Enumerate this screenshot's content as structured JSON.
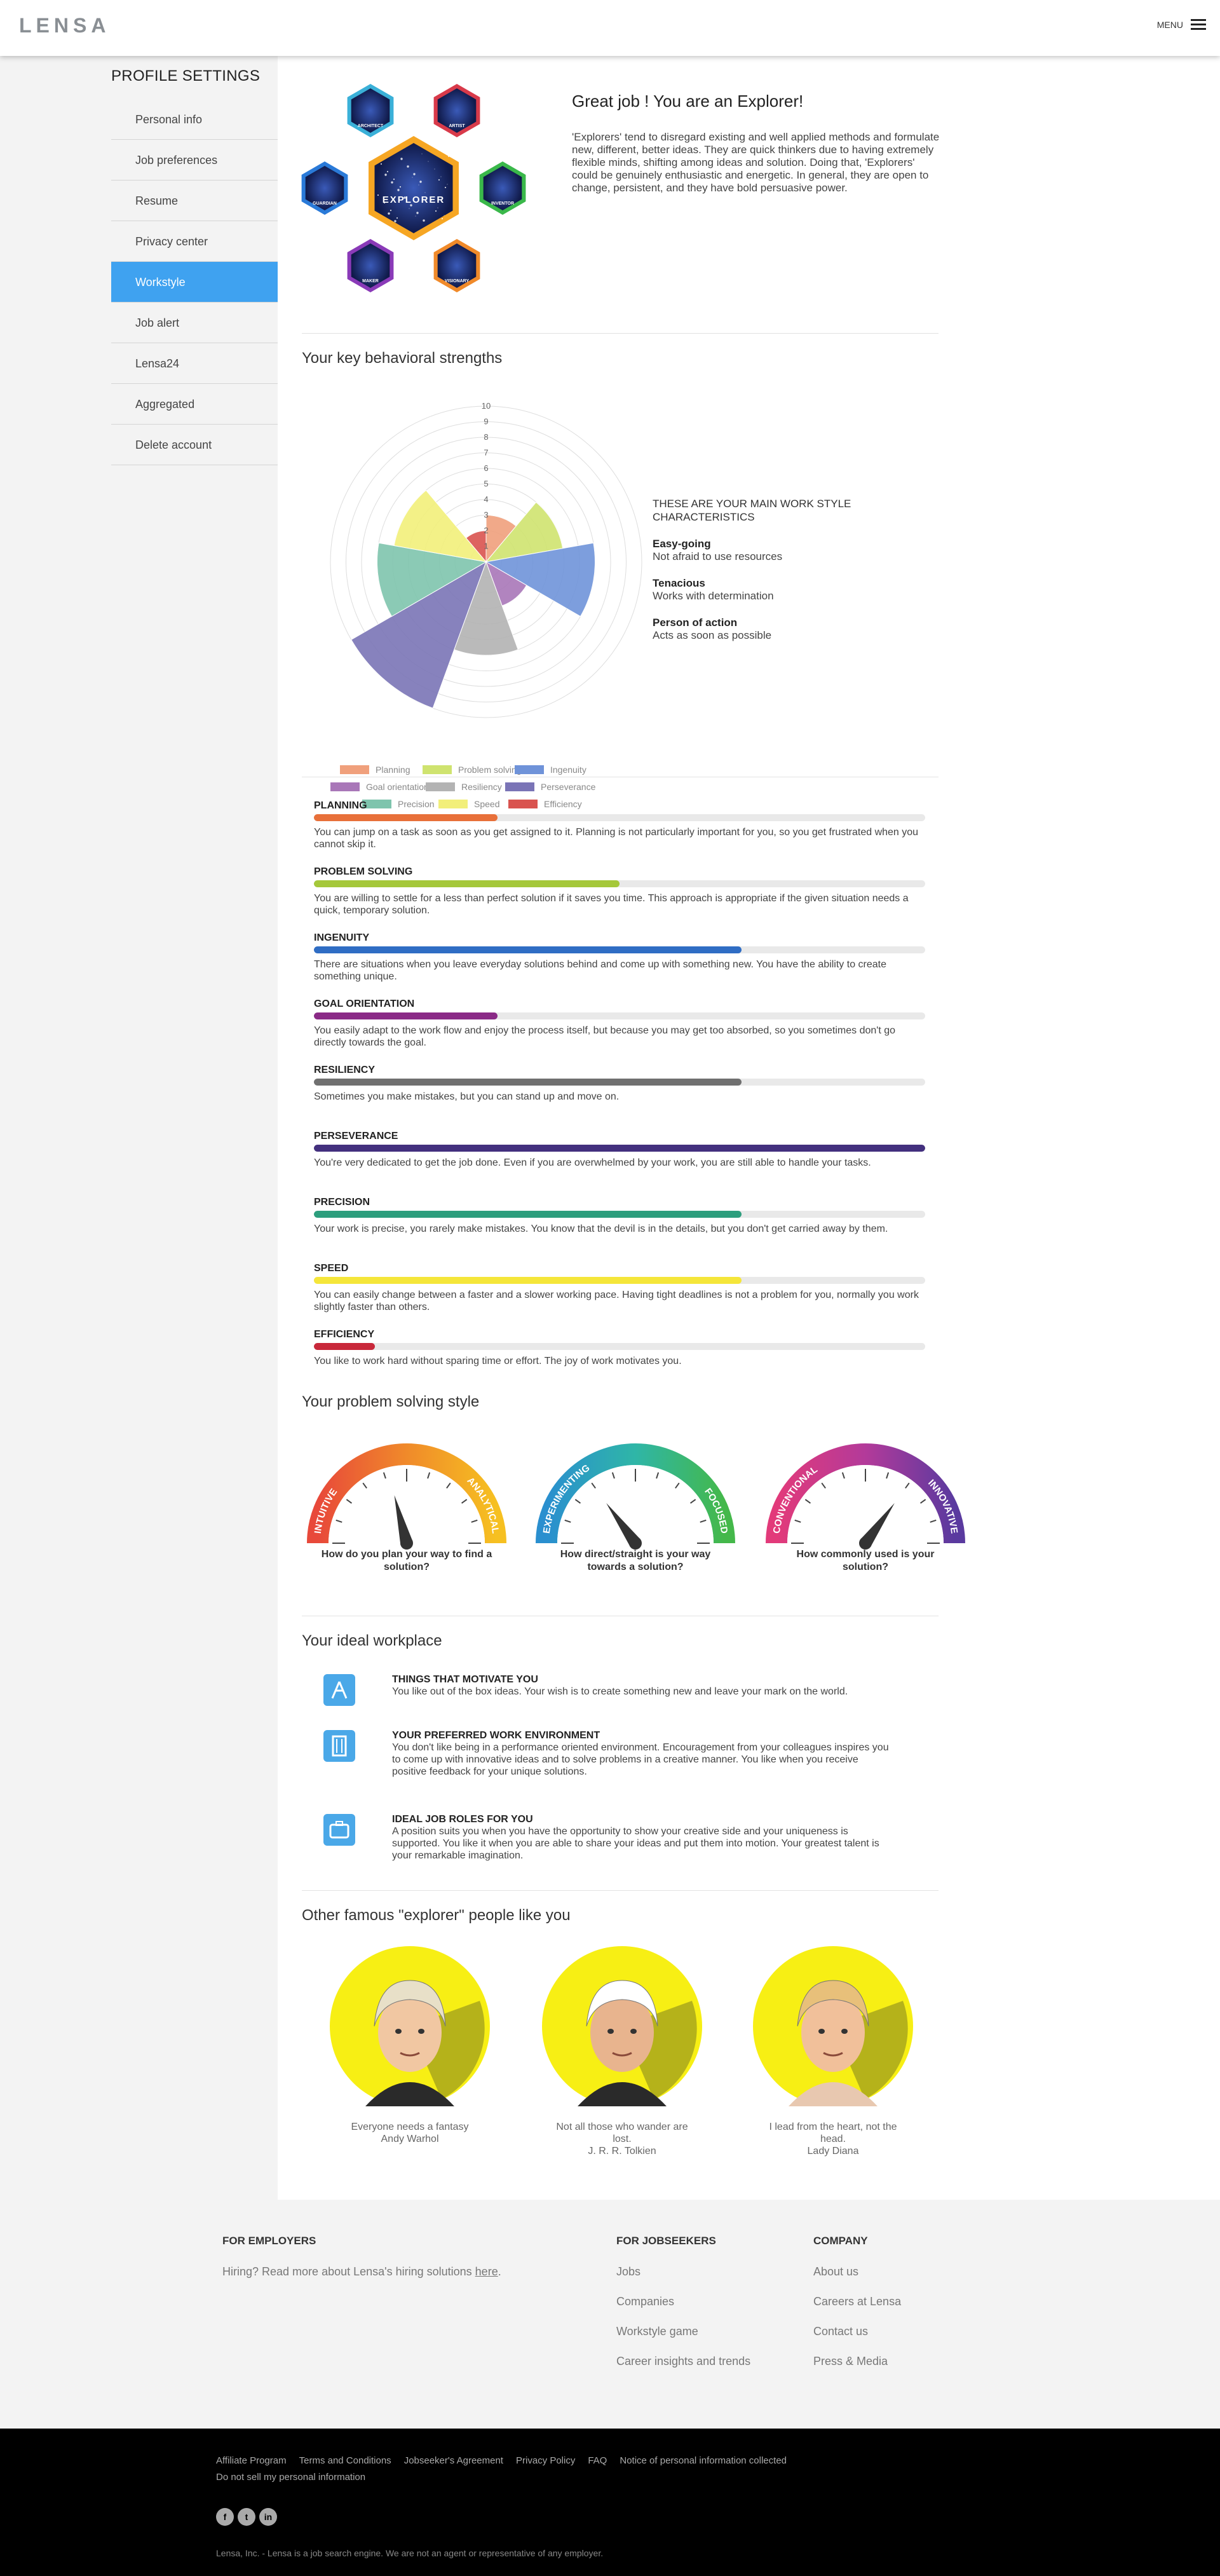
{
  "header": {
    "logo": "LENSA",
    "menu_label": "MENU"
  },
  "sidebar": {
    "title": "PROFILE SETTINGS",
    "items": [
      {
        "label": "Personal info",
        "active": false
      },
      {
        "label": "Job preferences",
        "active": false
      },
      {
        "label": "Resume",
        "active": false
      },
      {
        "label": "Privacy center",
        "active": false
      },
      {
        "label": "Workstyle",
        "active": true
      },
      {
        "label": "Job alert",
        "active": false
      },
      {
        "label": "Lensa24",
        "active": false
      },
      {
        "label": "Aggregated",
        "active": false
      },
      {
        "label": "Delete account",
        "active": false
      }
    ]
  },
  "result": {
    "badges": {
      "center": "EXPLORER",
      "ring": [
        "ARCHITECT",
        "ARTIST",
        "INVENTOR",
        "VISIONARY",
        "MAKER",
        "GUARDIAN"
      ]
    },
    "title": "Great job ! You are an Explorer!",
    "text": "'Explorers' tend to disregard existing and well applied methods and formulate new, different, better ideas. They are quick thinkers due to having extremely flexible minds, shifting among ideas and solution. Doing that, 'Explorers' could be genuinely enthusiastic and energetic. In general, they are open to change, persistent, and they have bold persuasive power."
  },
  "strengths": {
    "title": "Your key behavioral strengths",
    "legend_heading": "THESE ARE YOUR MAIN WORK STYLE CHARACTERISTICS",
    "highlights": [
      {
        "title": "Easy-going",
        "text": "Not afraid to use resources"
      },
      {
        "title": "Tenacious",
        "text": "Works with determination"
      },
      {
        "title": "Person of action",
        "text": "Acts as soon as possible"
      }
    ]
  },
  "chart_data": {
    "type": "polar-area",
    "r_ticks": [
      "1",
      "2",
      "3",
      "4",
      "5",
      "6",
      "7",
      "8",
      "9",
      "10"
    ],
    "rlim": [
      0,
      10
    ],
    "series": [
      {
        "name": "Planning",
        "value": 3,
        "color": "#f0a07c"
      },
      {
        "name": "Problem solving",
        "value": 5,
        "color": "#cfe36f"
      },
      {
        "name": "Ingenuity",
        "value": 7,
        "color": "#6f93d9"
      },
      {
        "name": "Goal orientation",
        "value": 3,
        "color": "#a977b8"
      },
      {
        "name": "Resiliency",
        "value": 6,
        "color": "#b3b3b3"
      },
      {
        "name": "Perseverance",
        "value": 10,
        "color": "#7a74b6"
      },
      {
        "name": "Precision",
        "value": 7,
        "color": "#7ec4ad"
      },
      {
        "name": "Speed",
        "value": 6,
        "color": "#f2ef7a"
      },
      {
        "name": "Efficiency",
        "value": 2,
        "color": "#d9534f"
      }
    ]
  },
  "traits": [
    {
      "title": "PLANNING",
      "fill": 0.3,
      "color": "#e8703a",
      "text": "You can jump on a task as soon as you get assigned to it. Planning is not particularly important for you, so you get frustrated when you cannot skip it."
    },
    {
      "title": "PROBLEM SOLVING",
      "fill": 0.5,
      "color": "#a5c83a",
      "text": "You are willing to settle for a less than perfect solution if it saves you time. This approach is appropriate if the given situation needs a quick, temporary solution."
    },
    {
      "title": "INGENUITY",
      "fill": 0.7,
      "color": "#2f6dc4",
      "text": "There are situations when you leave everyday solutions behind and come up with something new. You have the ability to create something unique."
    },
    {
      "title": "GOAL ORIENTATION",
      "fill": 0.3,
      "color": "#8a2a86",
      "text": "You easily adapt to the work flow and enjoy the process itself, but because you may get too absorbed, so you sometimes don't go directly towards the goal."
    },
    {
      "title": "RESILIENCY",
      "fill": 0.7,
      "color": "#707070",
      "text": "Sometimes you make mistakes, but you can stand up and move on."
    },
    {
      "title": "PERSEVERANCE",
      "fill": 1.0,
      "color": "#43307e",
      "text": "You're very dedicated to get the job done. Even if you are overwhelmed by your work, you are still able to handle your tasks."
    },
    {
      "title": "PRECISION",
      "fill": 0.7,
      "color": "#2d9e7d",
      "text": "Your work is precise, you rarely make mistakes. You know that the devil is in the details, but you don't get carried away by them."
    },
    {
      "title": "SPEED",
      "fill": 0.7,
      "color": "#f5e63a",
      "text": "You can easily change between a faster and a slower working pace. Having tight deadlines is not a problem for you, normally you work slightly faster than others."
    },
    {
      "title": "EFFICIENCY",
      "fill": 0.1,
      "color": "#c8283a",
      "text": "You like to work hard without sparing time or effort. The joy of work motivates you."
    }
  ],
  "problem_solving": {
    "title": "Your problem solving style",
    "gauges": [
      {
        "left": "INTUITIVE",
        "right": "ANALYTICAL",
        "question": "How do you plan your way to find a solution?",
        "level": 0.42,
        "colors": [
          "#e8493a",
          "#f08a2a",
          "#f6c021"
        ]
      },
      {
        "left": "EXPERIMENTING",
        "right": "FOCUSED",
        "question": "How direct/straight is your way towards a solution?",
        "level": 0.3,
        "colors": [
          "#2a8fcf",
          "#2fb6a7",
          "#44b84a"
        ]
      },
      {
        "left": "CONVENTIONAL",
        "right": "INNOVATIVE",
        "question": "How commonly used is your solution?",
        "level": 0.7,
        "colors": [
          "#e23a7a",
          "#b33a9a",
          "#5a3a9f"
        ]
      }
    ]
  },
  "workplace": {
    "title": "Your ideal workplace",
    "items": [
      {
        "icon": "motivation-icon",
        "title": "THINGS THAT MOTIVATE YOU",
        "text": "You like out of the box ideas. Your wish is to create something new and leave your mark on the world."
      },
      {
        "icon": "building-icon",
        "title": "YOUR PREFERRED WORK ENVIRONMENT",
        "text": "You don't like being in a performance oriented environment. Encouragement from your colleagues inspires you to come up with innovative ideas and to solve problems in a creative manner. You like when you receive positive feedback for your unique solutions."
      },
      {
        "icon": "briefcase-icon",
        "title": "IDEAL JOB ROLES FOR YOU",
        "text": "A position suits you when you have the opportunity to show your creative side and your uniqueness is supported. You like it when you are able to share your ideas and put them into motion. Your greatest talent is your remarkable imagination."
      }
    ]
  },
  "famous": {
    "title": "Other famous \"explorer\" people like you",
    "people": [
      {
        "quote": "Everyone needs a fantasy",
        "name": "Andy Warhol"
      },
      {
        "quote": "Not all those who wander are lost.",
        "name": "J. R. R. Tolkien"
      },
      {
        "quote": "I lead from the heart, not the head.",
        "name": "Lady Diana"
      }
    ]
  },
  "footer": {
    "employers": {
      "title": "FOR EMPLOYERS",
      "text_pre": "Hiring? Read more about Lensa's hiring solutions ",
      "link": "here",
      "text_post": "."
    },
    "jobseekers": {
      "title": "FOR JOBSEEKERS",
      "links": [
        "Jobs",
        "Companies",
        "Workstyle game",
        "Career insights and trends"
      ]
    },
    "company": {
      "title": "COMPANY",
      "links": [
        "About us",
        "Careers at Lensa",
        "Contact us",
        "Press & Media"
      ]
    }
  },
  "bottom": {
    "links": [
      "Affiliate Program",
      "Terms and Conditions",
      "Jobseeker's Agreement",
      "Privacy Policy",
      "FAQ",
      "Notice of personal information collected"
    ],
    "link2": "Do not sell my personal information",
    "social": [
      "f",
      "t",
      "in"
    ],
    "legal": "Lensa, Inc. - Lensa is a job search engine. We are not an agent or representative of any employer."
  }
}
